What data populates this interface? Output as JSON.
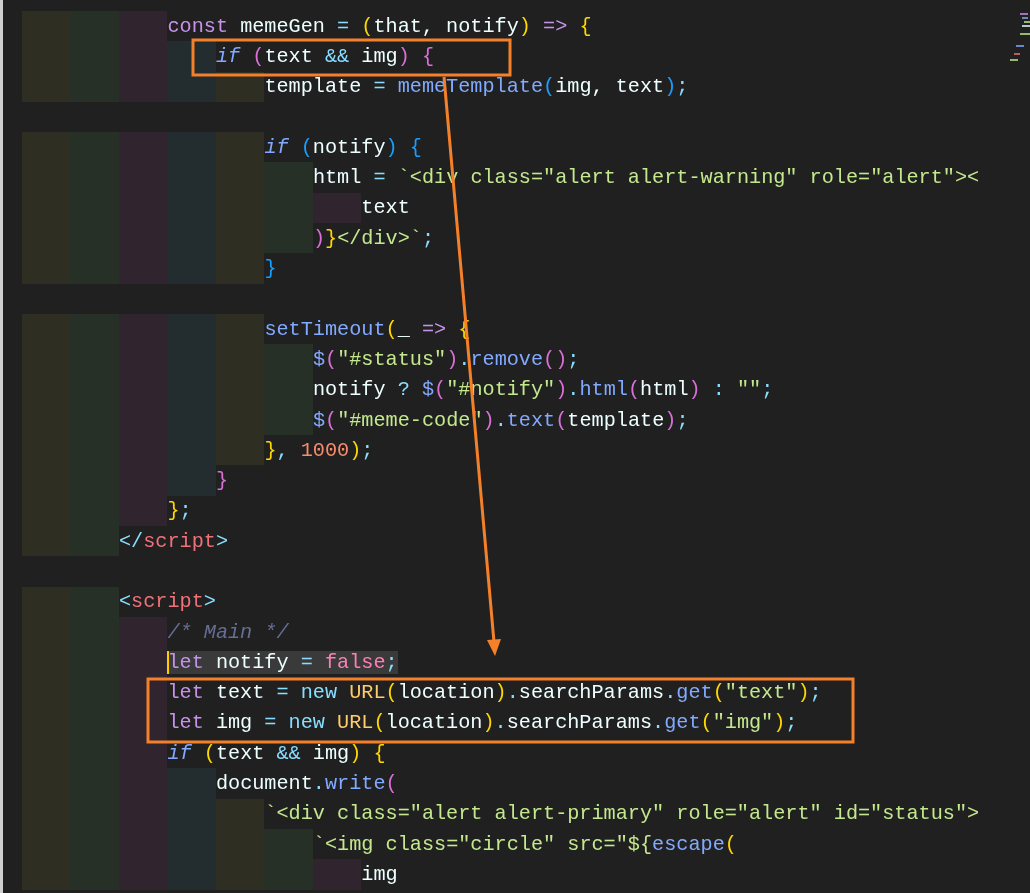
{
  "editor": {
    "lines": [
      {
        "kind": "code",
        "selected": false,
        "tokens": [
          {
            "kind": "keyword",
            "text": "const"
          },
          {
            "kind": "plain",
            "text": " memeGen "
          },
          {
            "kind": "operator",
            "text": "= "
          },
          {
            "kind": "bracket1",
            "text": "("
          },
          {
            "kind": "plain",
            "text": "that, notify"
          },
          {
            "kind": "bracket1",
            "text": ")"
          },
          {
            "kind": "keyword",
            "text": " => "
          },
          {
            "kind": "bracket1",
            "text": "{"
          }
        ]
      },
      {
        "kind": "code",
        "selected": false,
        "tokens": [
          {
            "kind": "control",
            "text": "if "
          },
          {
            "kind": "bracket2",
            "text": "("
          },
          {
            "kind": "plain",
            "text": "text "
          },
          {
            "kind": "operator",
            "text": "&&"
          },
          {
            "kind": "plain",
            "text": " img"
          },
          {
            "kind": "bracket2",
            "text": ")"
          },
          {
            "kind": "bracket2",
            "text": " {"
          }
        ]
      },
      {
        "kind": "code",
        "selected": false,
        "tokens": [
          {
            "kind": "plain",
            "text": "template "
          },
          {
            "kind": "operator",
            "text": "= "
          },
          {
            "kind": "function",
            "text": "memeTemplate"
          },
          {
            "kind": "bracket3",
            "text": "("
          },
          {
            "kind": "plain",
            "text": "img, text"
          },
          {
            "kind": "bracket3",
            "text": ")"
          },
          {
            "kind": "operator",
            "text": ";"
          }
        ]
      },
      {
        "kind": "blank",
        "selected": false
      },
      {
        "kind": "code",
        "selected": false,
        "tokens": [
          {
            "kind": "control",
            "text": "if "
          },
          {
            "kind": "bracket3",
            "text": "("
          },
          {
            "kind": "plain",
            "text": "notify"
          },
          {
            "kind": "bracket3",
            "text": ")"
          },
          {
            "kind": "bracket3",
            "text": " {"
          }
        ]
      },
      {
        "kind": "code",
        "selected": false,
        "tokens": [
          {
            "kind": "plain",
            "text": "html "
          },
          {
            "kind": "operator",
            "text": "="
          },
          {
            "kind": "string",
            "text": " `<div class=\"alert alert-warning\" role=\"alert\"><"
          }
        ]
      },
      {
        "kind": "code",
        "selected": false,
        "tokens": [
          {
            "kind": "plain",
            "text": "text"
          }
        ]
      },
      {
        "kind": "code",
        "selected": false,
        "tokens": [
          {
            "kind": "bracket2",
            "text": ")"
          },
          {
            "kind": "bracket1",
            "text": "}"
          },
          {
            "kind": "string",
            "text": "</div>`"
          },
          {
            "kind": "operator",
            "text": ";"
          }
        ]
      },
      {
        "kind": "code",
        "selected": false,
        "tokens": [
          {
            "kind": "bracket3",
            "text": "}"
          }
        ]
      },
      {
        "kind": "blank",
        "selected": false
      },
      {
        "kind": "code",
        "selected": false,
        "tokens": [
          {
            "kind": "function",
            "text": "setTimeout"
          },
          {
            "kind": "bracket1",
            "text": "("
          },
          {
            "kind": "plain",
            "text": "_ "
          },
          {
            "kind": "keyword",
            "text": "=>"
          },
          {
            "kind": "bracket1",
            "text": " {"
          }
        ]
      },
      {
        "kind": "code",
        "selected": false,
        "tokens": [
          {
            "kind": "function",
            "text": "$"
          },
          {
            "kind": "bracket2",
            "text": "("
          },
          {
            "kind": "string",
            "text": "\"#status\""
          },
          {
            "kind": "bracket2",
            "text": ")"
          },
          {
            "kind": "operator",
            "text": "."
          },
          {
            "kind": "function",
            "text": "remove"
          },
          {
            "kind": "bracket2",
            "text": "()"
          },
          {
            "kind": "operator",
            "text": ";"
          }
        ]
      },
      {
        "kind": "code",
        "selected": false,
        "tokens": [
          {
            "kind": "plain",
            "text": "notify "
          },
          {
            "kind": "operator",
            "text": "? "
          },
          {
            "kind": "function",
            "text": "$"
          },
          {
            "kind": "bracket2",
            "text": "("
          },
          {
            "kind": "string",
            "text": "\"#notify\""
          },
          {
            "kind": "bracket2",
            "text": ")"
          },
          {
            "kind": "operator",
            "text": "."
          },
          {
            "kind": "function",
            "text": "html"
          },
          {
            "kind": "bracket2",
            "text": "("
          },
          {
            "kind": "plain",
            "text": "html"
          },
          {
            "kind": "bracket2",
            "text": ")"
          },
          {
            "kind": "operator",
            "text": " : "
          },
          {
            "kind": "string",
            "text": "\"\""
          },
          {
            "kind": "operator",
            "text": ";"
          }
        ]
      },
      {
        "kind": "code",
        "selected": false,
        "tokens": [
          {
            "kind": "function",
            "text": "$"
          },
          {
            "kind": "bracket2",
            "text": "("
          },
          {
            "kind": "string",
            "text": "\"#meme-code\""
          },
          {
            "kind": "bracket2",
            "text": ")"
          },
          {
            "kind": "operator",
            "text": "."
          },
          {
            "kind": "function",
            "text": "text"
          },
          {
            "kind": "bracket2",
            "text": "("
          },
          {
            "kind": "plain",
            "text": "template"
          },
          {
            "kind": "bracket2",
            "text": ")"
          },
          {
            "kind": "operator",
            "text": ";"
          }
        ]
      },
      {
        "kind": "code",
        "selected": false,
        "tokens": [
          {
            "kind": "bracket1",
            "text": "}"
          },
          {
            "kind": "operator",
            "text": ", "
          },
          {
            "kind": "number",
            "text": "1000"
          },
          {
            "kind": "bracket1",
            "text": ")"
          },
          {
            "kind": "operator",
            "text": ";"
          }
        ]
      },
      {
        "kind": "code",
        "selected": false,
        "tokens": [
          {
            "kind": "bracket2",
            "text": "}"
          }
        ]
      },
      {
        "kind": "code",
        "selected": false,
        "tokens": [
          {
            "kind": "bracket1",
            "text": "}"
          },
          {
            "kind": "operator",
            "text": ";"
          }
        ]
      },
      {
        "kind": "code",
        "selected": false,
        "tokens": [
          {
            "kind": "operator",
            "text": "</"
          },
          {
            "kind": "tag",
            "text": "script"
          },
          {
            "kind": "operator",
            "text": ">"
          }
        ]
      },
      {
        "kind": "blank",
        "selected": false
      },
      {
        "kind": "code",
        "selected": false,
        "tokens": [
          {
            "kind": "operator",
            "text": "<"
          },
          {
            "kind": "tag",
            "text": "script"
          },
          {
            "kind": "operator",
            "text": ">"
          }
        ]
      },
      {
        "kind": "code",
        "selected": false,
        "tokens": [
          {
            "kind": "comment",
            "text": "/* Main */"
          }
        ]
      },
      {
        "kind": "code",
        "selected": true,
        "tokens": [
          {
            "kind": "keyword",
            "text": "let"
          },
          {
            "kind": "plain",
            "text": " notify "
          },
          {
            "kind": "operator",
            "text": "= "
          },
          {
            "kind": "boolean",
            "text": "false"
          },
          {
            "kind": "operator",
            "text": ";"
          }
        ]
      },
      {
        "kind": "code",
        "selected": false,
        "tokens": [
          {
            "kind": "keyword",
            "text": "let"
          },
          {
            "kind": "plain",
            "text": " text "
          },
          {
            "kind": "operator",
            "text": "= new "
          },
          {
            "kind": "class",
            "text": "URL"
          },
          {
            "kind": "bracket1",
            "text": "("
          },
          {
            "kind": "plain",
            "text": "location"
          },
          {
            "kind": "bracket1",
            "text": ")"
          },
          {
            "kind": "operator",
            "text": "."
          },
          {
            "kind": "plain",
            "text": "searchParams"
          },
          {
            "kind": "operator",
            "text": "."
          },
          {
            "kind": "function",
            "text": "get"
          },
          {
            "kind": "bracket1",
            "text": "("
          },
          {
            "kind": "string",
            "text": "\"text\""
          },
          {
            "kind": "bracket1",
            "text": ")"
          },
          {
            "kind": "operator",
            "text": ";"
          }
        ]
      },
      {
        "kind": "code",
        "selected": false,
        "tokens": [
          {
            "kind": "keyword",
            "text": "let"
          },
          {
            "kind": "plain",
            "text": " img "
          },
          {
            "kind": "operator",
            "text": "= new "
          },
          {
            "kind": "class",
            "text": "URL"
          },
          {
            "kind": "bracket1",
            "text": "("
          },
          {
            "kind": "plain",
            "text": "location"
          },
          {
            "kind": "bracket1",
            "text": ")"
          },
          {
            "kind": "operator",
            "text": "."
          },
          {
            "kind": "plain",
            "text": "searchParams"
          },
          {
            "kind": "operator",
            "text": "."
          },
          {
            "kind": "function",
            "text": "get"
          },
          {
            "kind": "bracket1",
            "text": "("
          },
          {
            "kind": "string",
            "text": "\"img\""
          },
          {
            "kind": "bracket1",
            "text": ")"
          },
          {
            "kind": "operator",
            "text": ";"
          }
        ]
      },
      {
        "kind": "code",
        "selected": false,
        "tokens": [
          {
            "kind": "control",
            "text": "if "
          },
          {
            "kind": "bracket1",
            "text": "("
          },
          {
            "kind": "plain",
            "text": "text "
          },
          {
            "kind": "operator",
            "text": "&&"
          },
          {
            "kind": "plain",
            "text": " img"
          },
          {
            "kind": "bracket1",
            "text": ")"
          },
          {
            "kind": "bracket1",
            "text": " {"
          }
        ]
      },
      {
        "kind": "code",
        "selected": false,
        "tokens": [
          {
            "kind": "plain",
            "text": "document"
          },
          {
            "kind": "operator",
            "text": "."
          },
          {
            "kind": "function",
            "text": "write"
          },
          {
            "kind": "bracket2",
            "text": "("
          }
        ]
      },
      {
        "kind": "code",
        "selected": false,
        "tokens": [
          {
            "kind": "string",
            "text": "`<div class=\"alert alert-primary\" role=\"alert\" id=\"status\">"
          }
        ]
      },
      {
        "kind": "code",
        "selected": false,
        "tokens": [
          {
            "kind": "string",
            "text": "`<img class=\"circle\" src=\"${"
          },
          {
            "kind": "function",
            "text": "escape"
          },
          {
            "kind": "bracket1",
            "text": "("
          }
        ]
      },
      {
        "kind": "code",
        "selected": false,
        "tokens": [
          {
            "kind": "plain",
            "text": "img"
          }
        ]
      }
    ]
  },
  "annotations": [
    {
      "kind": "box"
    },
    {
      "kind": "box"
    },
    {
      "kind": "arrow"
    }
  ]
}
